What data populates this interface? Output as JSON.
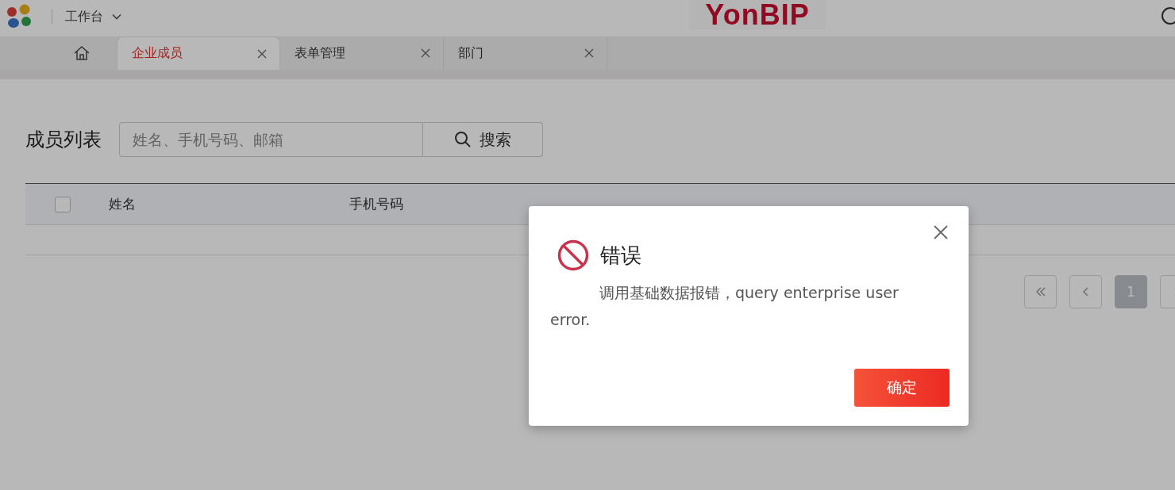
{
  "header": {
    "workspace": "工作台",
    "brand": "YonBIP"
  },
  "tabs": [
    {
      "label": "企业成员",
      "selected": true
    },
    {
      "label": "表单管理",
      "selected": false
    },
    {
      "label": "部门",
      "selected": false
    }
  ],
  "page": {
    "title": "成员列表",
    "search": {
      "placeholder": "姓名、手机号码、邮箱",
      "button": "搜索"
    }
  },
  "table": {
    "select_all": {
      "checked": false
    },
    "columns": [
      "姓名",
      "手机号码"
    ]
  },
  "pagination": {
    "pages": [
      {
        "label": "1",
        "selected": true
      }
    ]
  },
  "dialog": {
    "title": "错误",
    "message": "调用基础数据报错，query enterprise user error.",
    "confirm": "确定"
  }
}
